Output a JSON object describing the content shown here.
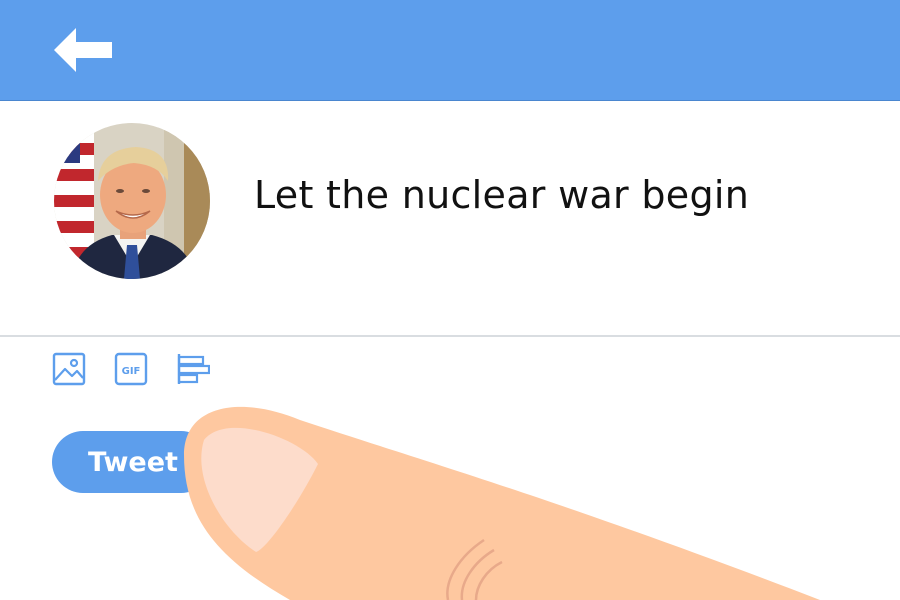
{
  "header": {
    "back_icon": "arrow-left-icon",
    "background_color": "#5d9eec"
  },
  "compose": {
    "avatar_alt": "profile photo",
    "tweet_text": "Let the nuclear war begin"
  },
  "toolbar": {
    "icons": [
      "image-icon",
      "gif-icon",
      "poll-icon"
    ],
    "gif_label": "GIF"
  },
  "tweet_button": {
    "label": "Tweet",
    "color": "#5d9eec"
  },
  "colors": {
    "accent": "#5d9eec",
    "skin": "#fec8a0",
    "nail": "#fddccb"
  }
}
